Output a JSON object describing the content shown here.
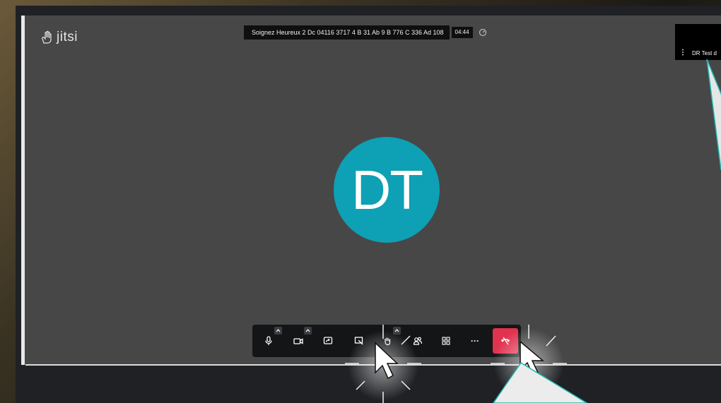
{
  "colors": {
    "stage_bg": "#474747",
    "avatar_bg": "#0ea0b5",
    "hangup": "#e0334f",
    "toolbar_bg": "#141516",
    "callout": "#1fb8b2"
  },
  "app": {
    "logo_text": "jitsi"
  },
  "meeting": {
    "subject": "Soignez Heureux 2 Dc 04116 3717 4 B 31 Ab 9 B 776 C 336 Ad 108",
    "timer": "04:44"
  },
  "participant": {
    "initials": "DT",
    "thumbnail_name": "DR Test d",
    "thumbnail_menu": "⋮"
  },
  "toolbar": {
    "buttons": [
      {
        "name": "microphone-button",
        "icon": "microphone-icon"
      },
      {
        "name": "camera-button",
        "icon": "camera-icon"
      },
      {
        "name": "share-screen-button",
        "icon": "screen-share-icon"
      },
      {
        "name": "whiteboard-button",
        "icon": "whiteboard-icon"
      },
      {
        "name": "raise-hand-button",
        "icon": "hand-icon"
      },
      {
        "name": "participants-button",
        "icon": "participants-icon"
      },
      {
        "name": "tile-view-button",
        "icon": "grid-icon"
      },
      {
        "name": "more-actions-button",
        "icon": "more-icon",
        "label": "···"
      },
      {
        "name": "hangup-button",
        "icon": "phone-hangup-icon"
      }
    ]
  }
}
